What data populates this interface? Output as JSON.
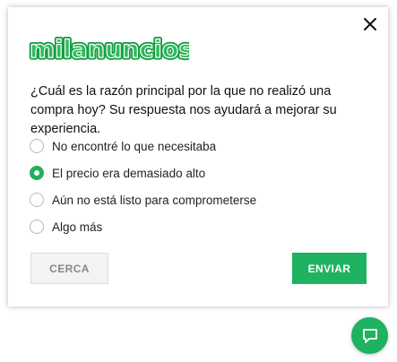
{
  "brand": {
    "name": "milanuncios",
    "color": "#2bbd5a"
  },
  "survey": {
    "question": "¿Cuál es la razón principal por la que no realizó una compra hoy? Su respuesta nos ayudará a mejorar su experiencia.",
    "options": [
      {
        "label": "No encontré lo que necesitaba",
        "selected": false
      },
      {
        "label": "El precio era demasiado alto",
        "selected": true
      },
      {
        "label": "Aún no está listo para comprometerse",
        "selected": false
      },
      {
        "label": "Algo más",
        "selected": false
      }
    ]
  },
  "buttons": {
    "close_label": "CERCA",
    "send_label": "ENVIAR"
  },
  "icons": {
    "close": "close-icon",
    "chat": "chat-icon"
  },
  "colors": {
    "accent": "#1eb261",
    "text": "#111111",
    "secondary_button_bg": "#f3f3f3"
  }
}
